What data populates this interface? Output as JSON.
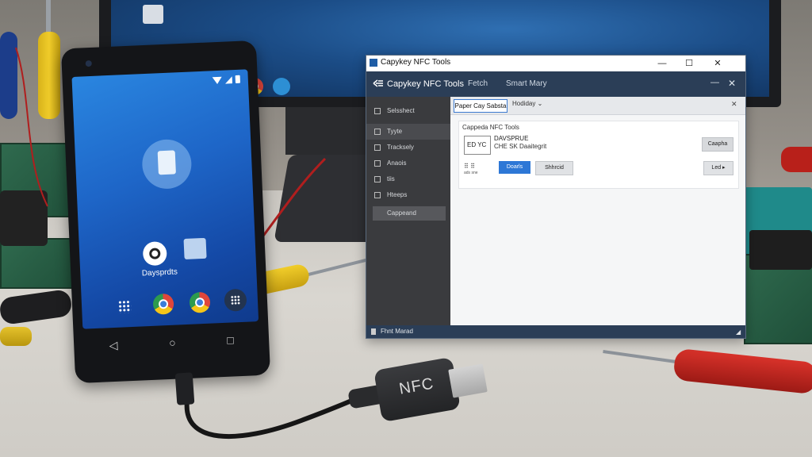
{
  "window": {
    "title": "Capykey NFC Tools",
    "controls": {
      "minimize": "—",
      "maximize": "☐",
      "close": "✕"
    }
  },
  "appbar": {
    "name": "Capykey NFC Tools",
    "menu": [
      "Fetch",
      "Smart Mary"
    ],
    "min": "—",
    "close": "✕"
  },
  "sidebar": {
    "items": [
      "Selsshect",
      "Tyyte",
      "Tracksely",
      "Anaois",
      "tiis",
      "Hteeps",
      "Cappeand"
    ]
  },
  "tabs": {
    "active": "Paper Cay Sabsta",
    "second": "Hodiday ⌄",
    "close": "✕"
  },
  "panel": {
    "title": "Cappeda NFC Tools",
    "card_label": "ED YC",
    "info_line1": "DAVSPRUE",
    "info_line2": "CHE SK Daaitegrit",
    "button_right1": "Caapha",
    "small_icons": "⠿ ⠿",
    "small_icons_sub": "ads  sne",
    "button_blue": "Doarls",
    "button_gray": "Shhrcid",
    "button_right2": "Led ▸"
  },
  "statusbar": {
    "text": "Fhnt Marad",
    "grip": "◢"
  },
  "phone": {
    "app_label": "Daysprdts",
    "nav": {
      "back": "◁",
      "home": "○",
      "recent": "□"
    }
  },
  "dongle": {
    "label": "NFC"
  }
}
